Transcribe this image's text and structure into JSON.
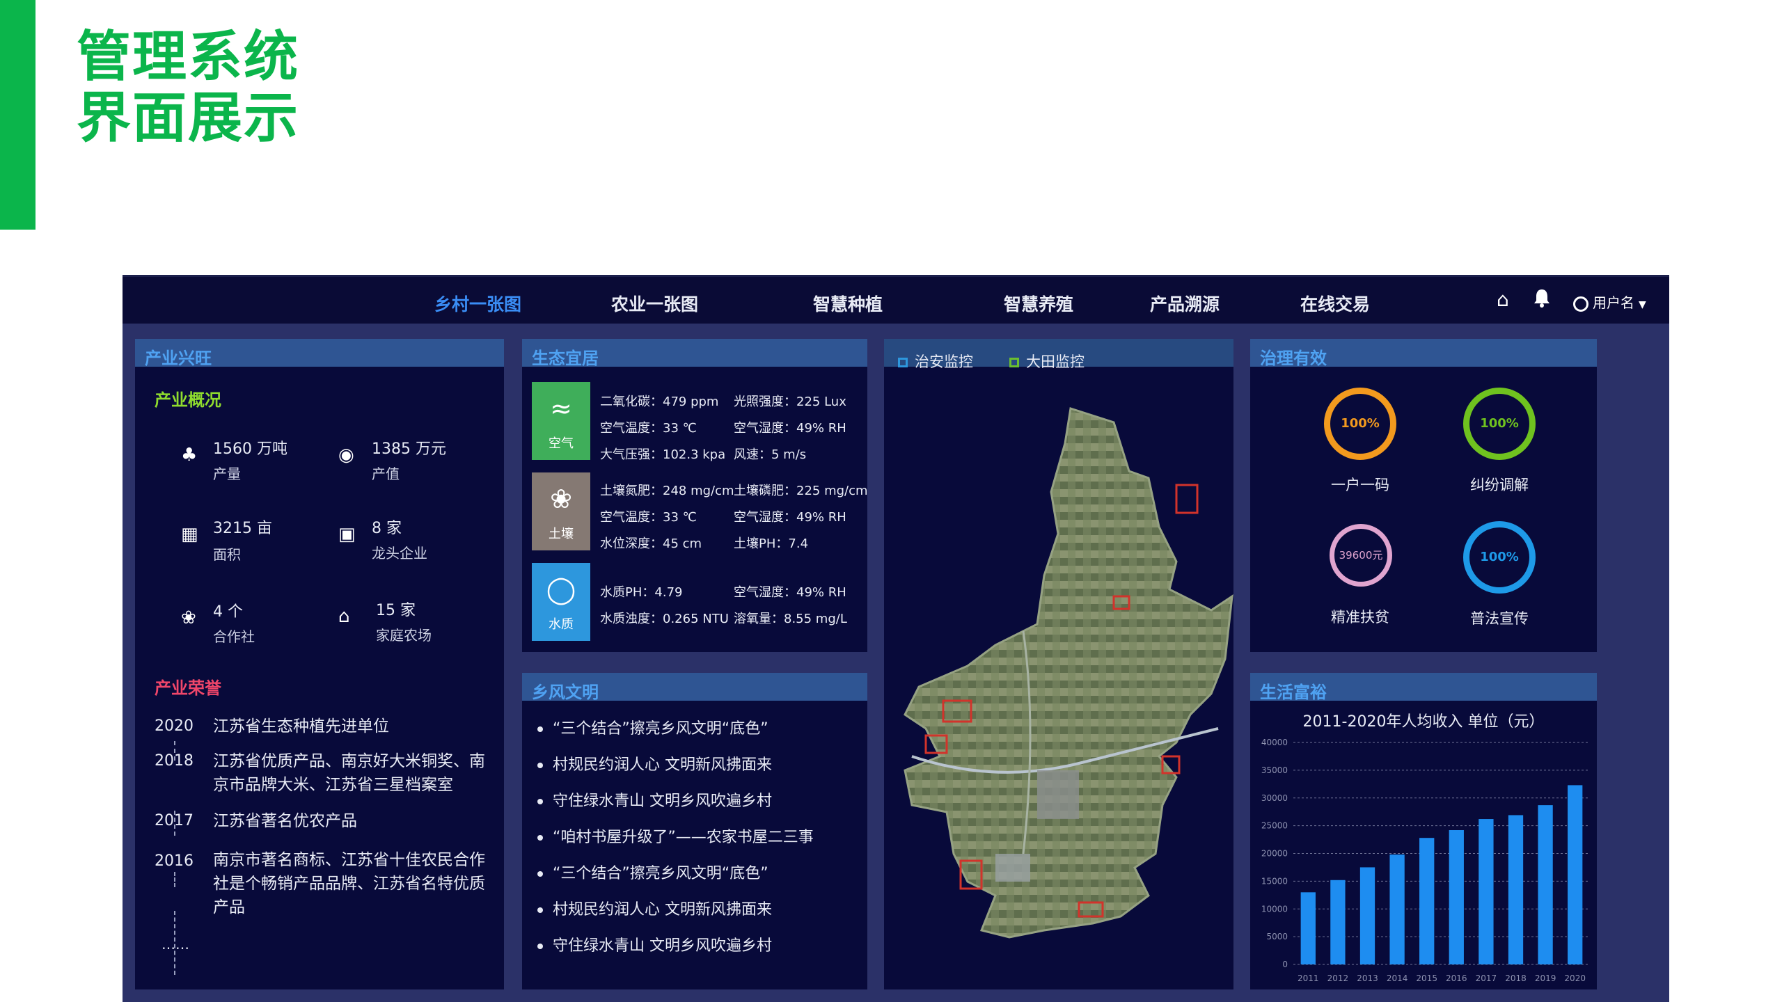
{
  "slide": {
    "title_line1": "管理系统",
    "title_line2": "界面展示",
    "accent_color": "#0bb54b"
  },
  "nav": {
    "items": [
      {
        "label": "乡村一张图",
        "active": true
      },
      {
        "label": "农业一张图",
        "active": false
      },
      {
        "label": "智慧种植",
        "active": false
      },
      {
        "label": "智慧养殖",
        "active": false
      },
      {
        "label": "产品溯源",
        "active": false
      },
      {
        "label": "在线交易",
        "active": false
      }
    ],
    "home_icon": "home-icon",
    "bell_icon": "bell-icon",
    "user_icon": "user-circle-icon",
    "user_label": "用户名"
  },
  "industry": {
    "title": "产业兴旺",
    "overview_title": "产业概况",
    "stats": [
      {
        "icon": "output-icon",
        "value": "1560 万吨",
        "label": "产量"
      },
      {
        "icon": "money-icon",
        "value": "1385 万元",
        "label": "产值"
      },
      {
        "icon": "map-icon",
        "value": "3215 亩",
        "label": "面积"
      },
      {
        "icon": "factory-icon",
        "value": "8 家",
        "label": "龙头企业"
      },
      {
        "icon": "cooperative-icon",
        "value": "4 个",
        "label": "合作社"
      },
      {
        "icon": "farm-house-icon",
        "value": "15 家",
        "label": "家庭农场"
      }
    ],
    "honors_title": "产业荣誉",
    "honors": [
      {
        "year": "2020",
        "text": "江苏省生态种植先进单位"
      },
      {
        "year": "2018",
        "text": "江苏省优质产品、南京好大米铜奖、南京市品牌大米、江苏省三星档案室"
      },
      {
        "year": "2017",
        "text": "江苏省著名优农产品"
      },
      {
        "year": "2016",
        "text": "南京市著名商标、江苏省十佳农民合作社是个畅销产品品牌、江苏省名特优质产品"
      }
    ],
    "honors_more": "……"
  },
  "ecology": {
    "title": "生态宜居",
    "groups": [
      {
        "icon": "wind-icon",
        "label": "空气",
        "color": "#3fae5a",
        "cells": [
          "二氧化碳：479 ppm",
          "光照强度：225 Lux",
          "空气温度：33 ℃",
          "空气湿度：49% RH",
          "大气压强：102.3 kpa",
          "风速：5 m/s"
        ]
      },
      {
        "icon": "sprout-icon",
        "label": "土壤",
        "color": "#857973",
        "cells": [
          "土壤氮肥：248 mg/cm",
          "土壤磷肥：225 mg/cm",
          "空气温度：33 ℃",
          "空气湿度：49% RH",
          "水位深度：45 cm",
          "土壤PH：7.4"
        ]
      },
      {
        "icon": "water-drop-icon",
        "label": "水质",
        "color": "#2d97dd",
        "cells": [
          "水质PH：4.79",
          "空气湿度：49% RH",
          "水质浊度：0.265 NTU",
          "溶氧量：8.55 mg/L"
        ]
      }
    ]
  },
  "culture": {
    "title": "乡风文明",
    "items": [
      "“三个结合”擦亮乡风文明“底色”",
      "村规民约润人心 文明新风拂面来",
      "守住绿水青山 文明乡风吹遍乡村",
      "“咱村书屋升级了”——农家书屋二三事",
      "“三个结合”擦亮乡风文明“底色”",
      "村规民约润人心 文明新风拂面来",
      "守住绿水青山 文明乡风吹遍乡村"
    ]
  },
  "monitor": {
    "tabs": [
      {
        "label": "治安监控",
        "color": "#2d97dd"
      },
      {
        "label": "大田监控",
        "color": "#6bbf2f"
      }
    ]
  },
  "governance": {
    "title": "治理有效",
    "rings": [
      {
        "value": "100%",
        "label": "一户一码",
        "color": "#f39a1e"
      },
      {
        "value": "100%",
        "label": "纠纷调解",
        "color": "#6fc21f"
      },
      {
        "value": "39600元",
        "label": "精准扶贫",
        "color": "#e0a4cf"
      },
      {
        "value": "100%",
        "label": "普法宣传",
        "color": "#1e9ae8"
      }
    ]
  },
  "wealth": {
    "title": "生活富裕"
  },
  "chart_data": {
    "type": "bar",
    "title": "2011-2020年人均收入    单位（元）",
    "categories": [
      "2011",
      "2012",
      "2013",
      "2014",
      "2015",
      "2016",
      "2017",
      "2018",
      "2019",
      "2020"
    ],
    "values": [
      13000,
      15200,
      17500,
      19800,
      22800,
      24200,
      26200,
      26900,
      28700,
      32300
    ],
    "ylim": [
      0,
      40000
    ],
    "yticks": [
      "0",
      "5000",
      "10000",
      "15000",
      "20000",
      "25000",
      "30000",
      "35000",
      "40000"
    ],
    "bar_color": "#1e8df0",
    "grid": true
  }
}
